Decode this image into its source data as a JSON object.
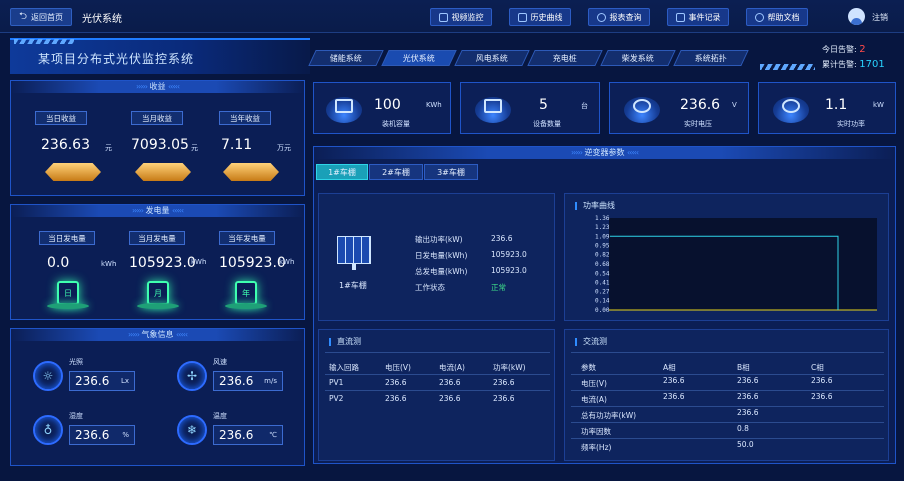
{
  "topbar": {
    "back_label": "返回首页",
    "app_title": "光伏系统",
    "buttons": [
      {
        "label": "视频监控",
        "icon": "video-icon"
      },
      {
        "label": "历史曲线",
        "icon": "chart-icon"
      },
      {
        "label": "报表查询",
        "icon": "search-icon"
      },
      {
        "label": "事件记录",
        "icon": "document-icon"
      },
      {
        "label": "帮助文档",
        "icon": "help-icon"
      }
    ],
    "logout_label": "注销"
  },
  "header": {
    "title": "某项目分布式光伏监控系统",
    "tabs": [
      "储能系统",
      "光伏系统",
      "风电系统",
      "充电桩",
      "柴发系统",
      "系统拓扑"
    ],
    "alarm_today_label": "今日告警:",
    "alarm_today_value": "2",
    "alarm_total_label": "累计告警:",
    "alarm_total_value": "1701"
  },
  "income": {
    "title": "收益",
    "items": [
      {
        "label": "当日收益",
        "value": "236.63",
        "unit": "元"
      },
      {
        "label": "当月收益",
        "value": "7093.05",
        "unit": "元"
      },
      {
        "label": "当年收益",
        "value": "7.11",
        "unit": "万元"
      }
    ]
  },
  "generation": {
    "title": "发电量",
    "items": [
      {
        "label": "当日发电量",
        "value": "0.0",
        "unit": "kWh",
        "glyph": "日"
      },
      {
        "label": "当月发电量",
        "value": "105923.0",
        "unit": "kWh",
        "glyph": "月"
      },
      {
        "label": "当年发电量",
        "value": "105923.0",
        "unit": "kWh",
        "glyph": "年"
      }
    ]
  },
  "weather": {
    "title": "气象信息",
    "items": [
      {
        "label": "光照",
        "value": "236.6",
        "unit": "Lx",
        "icon": "sun-icon"
      },
      {
        "label": "风速",
        "value": "236.6",
        "unit": "m/s",
        "icon": "fan-icon"
      },
      {
        "label": "湿度",
        "value": "236.6",
        "unit": "%",
        "icon": "droplet-icon"
      },
      {
        "label": "温度",
        "value": "236.6",
        "unit": "℃",
        "icon": "thermometer-icon"
      }
    ]
  },
  "kpis": [
    {
      "value": "100",
      "unit": "KWh",
      "label": "装机容量",
      "icon": "battery-icon"
    },
    {
      "value": "5",
      "unit": "台",
      "label": "设备数量",
      "icon": "server-icon"
    },
    {
      "value": "236.6",
      "unit": "V",
      "label": "实时电压",
      "icon": "gauge-icon"
    },
    {
      "value": "1.1",
      "unit": "kW",
      "label": "实时功率",
      "icon": "pulse-icon"
    }
  ],
  "inverter": {
    "title": "逆变器参数",
    "tabs": [
      "1#车棚",
      "2#车棚",
      "3#车棚"
    ],
    "device_name": "1#车棚",
    "params": [
      {
        "label": "输出功率(kW)",
        "value": "236.6"
      },
      {
        "label": "日发电量(kWh)",
        "value": "105923.0"
      },
      {
        "label": "总发电量(kWh)",
        "value": "105923.0"
      },
      {
        "label": "工作状态",
        "value": "正常"
      }
    ],
    "status_color": "#3fe08a"
  },
  "power_curve": {
    "title": "功率曲线"
  },
  "chart_data": {
    "type": "line",
    "title": "功率曲线",
    "y_ticks": [
      "1.36",
      "1.23",
      "1.09",
      "0.95",
      "0.82",
      "0.68",
      "0.54",
      "0.41",
      "0.27",
      "0.14",
      "0.00"
    ],
    "ylim": [
      0,
      1.36
    ],
    "series": [
      {
        "values": [
          1.09,
          1.09,
          1.09,
          1.09,
          1.09,
          1.09,
          1.09,
          1.09,
          1.09,
          1.09,
          1.09,
          1.09,
          1.09,
          1.09,
          1.09,
          1.09,
          1.09,
          1.09,
          1.09,
          1.09,
          1.09,
          1.09,
          1.09,
          1.09,
          1.09,
          1.09,
          1.09,
          1.09,
          1.09,
          0.0
        ]
      }
    ],
    "colors": [
      "#2fd4e8"
    ],
    "baseline_color": "#e6d21a",
    "grid": false
  },
  "dc": {
    "title": "直流测",
    "headers": [
      "输入回路",
      "电压(V)",
      "电流(A)",
      "功率(kW)"
    ],
    "rows": [
      [
        "PV1",
        "236.6",
        "236.6",
        "236.6"
      ],
      [
        "PV2",
        "236.6",
        "236.6",
        "236.6"
      ]
    ]
  },
  "ac": {
    "title": "交流测",
    "headers": [
      "参数",
      "A相",
      "B相",
      "C相"
    ],
    "rows": [
      [
        "电压(V)",
        "236.6",
        "236.6",
        "236.6"
      ],
      [
        "电流(A)",
        "236.6",
        "236.6",
        "236.6"
      ],
      [
        "总有功功率(kW)",
        "",
        "236.6",
        ""
      ],
      [
        "功率因数",
        "",
        "0.8",
        ""
      ],
      [
        "频率(Hz)",
        "",
        "50.0",
        ""
      ]
    ]
  }
}
